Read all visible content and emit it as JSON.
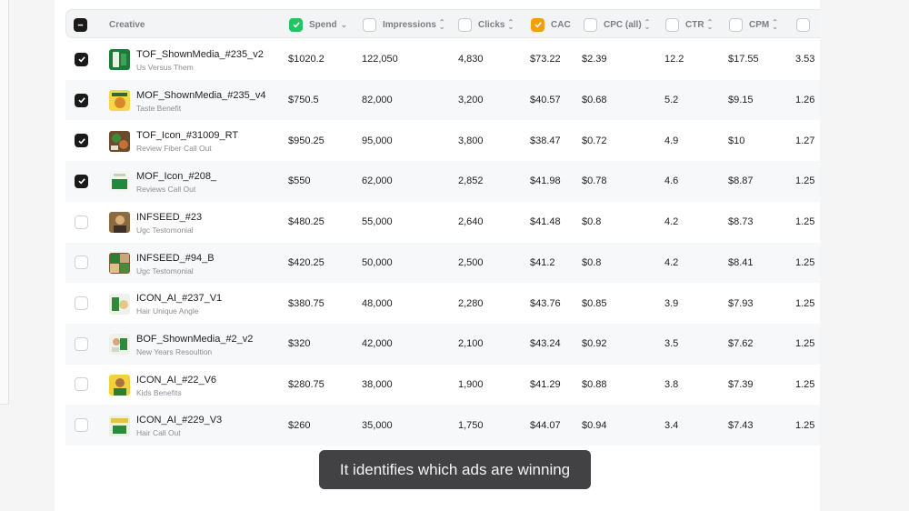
{
  "header": {
    "creative": "Creative",
    "spend": "Spend",
    "impressions": "Impressions",
    "clicks": "Clicks",
    "cac": "CAC",
    "cpc": "CPC (all)",
    "ctr": "CTR",
    "cpm": "CPM"
  },
  "rows": [
    {
      "checked": true,
      "thumb": "green",
      "title": "TOF_ShownMedia_#235_v2",
      "subtitle": "Us Versus Them",
      "spend": "$1020.2",
      "impressions": "122,050",
      "clicks": "4,830",
      "cac": "$73.22",
      "cpc": "$2.39",
      "ctr": "12.2",
      "cpm": "$17.55",
      "extra": "3.53"
    },
    {
      "checked": true,
      "thumb": "yellow",
      "title": "MOF_ShownMedia_#235_v4",
      "subtitle": "Taste Benefit",
      "spend": "$750.5",
      "impressions": "82,000",
      "clicks": "3,200",
      "cac": "$40.57",
      "cpc": "$0.68",
      "ctr": "5.2",
      "cpm": "$9.15",
      "extra": "1.26"
    },
    {
      "checked": true,
      "thumb": "food",
      "title": "TOF_Icon_#31009_RT",
      "subtitle": "Review Fiber Call Out",
      "spend": "$950.25",
      "impressions": "95,000",
      "clicks": "3,800",
      "cac": "$38.47",
      "cpc": "$0.72",
      "ctr": "4.9",
      "cpm": "$10",
      "extra": "1.27"
    },
    {
      "checked": true,
      "thumb": "white-green",
      "title": "MOF_Icon_#208_",
      "subtitle": "Reviews Call Out",
      "spend": "$550",
      "impressions": "62,000",
      "clicks": "2,852",
      "cac": "$41.98",
      "cpc": "$0.78",
      "ctr": "4.6",
      "cpm": "$8.87",
      "extra": "1.25"
    },
    {
      "checked": false,
      "thumb": "person",
      "title": "INFSEED_#23",
      "subtitle": "Ugc Testomonial",
      "spend": "$480.25",
      "impressions": "55,000",
      "clicks": "2,640",
      "cac": "$41.48",
      "cpc": "$0.8",
      "ctr": "4.2",
      "cpm": "$8.73",
      "extra": "1.25"
    },
    {
      "checked": false,
      "thumb": "collage",
      "title": "INFSEED_#94_B",
      "subtitle": "Ugc Testomonial",
      "spend": "$420.25",
      "impressions": "50,000",
      "clicks": "2,500",
      "cac": "$41.2",
      "cpc": "$0.8",
      "ctr": "4.2",
      "cpm": "$8.41",
      "extra": "1.25"
    },
    {
      "checked": false,
      "thumb": "light",
      "title": "ICON_AI_#237_V1",
      "subtitle": "Hair Unique Angle",
      "spend": "$380.75",
      "impressions": "48,000",
      "clicks": "2,280",
      "cac": "$43.76",
      "cpc": "$0.85",
      "ctr": "3.9",
      "cpm": "$7.93",
      "extra": "1.25"
    },
    {
      "checked": false,
      "thumb": "light2",
      "title": "BOF_ShownMedia_#2_v2",
      "subtitle": "New Years Resoultion",
      "spend": "$320",
      "impressions": "42,000",
      "clicks": "2,100",
      "cac": "$43.24",
      "cpc": "$0.92",
      "ctr": "3.5",
      "cpm": "$7.62",
      "extra": "1.25"
    },
    {
      "checked": false,
      "thumb": "yellow-person",
      "title": "ICON_AI_#22_V6",
      "subtitle": "Kids Benefits",
      "spend": "$280.75",
      "impressions": "38,000",
      "clicks": "1,900",
      "cac": "$41.29",
      "cpc": "$0.88",
      "ctr": "3.8",
      "cpm": "$7.39",
      "extra": "1.25"
    },
    {
      "checked": false,
      "thumb": "light-green",
      "title": "ICON_AI_#229_V3",
      "subtitle": "Hair Call Out",
      "spend": "$260",
      "impressions": "35,000",
      "clicks": "1,750",
      "cac": "$44.07",
      "cpc": "$0.94",
      "ctr": "3.4",
      "cpm": "$7.43",
      "extra": "1.25"
    }
  ],
  "caption": "It identifies which ads are winning",
  "colors": {
    "spend_check": "#22c55e",
    "cac_check": "#f59e0b",
    "row_check": "#1a1a1a"
  },
  "icons": {
    "check": "check-icon",
    "sort": "sort-icon",
    "chevron": "chevron-down-icon"
  }
}
